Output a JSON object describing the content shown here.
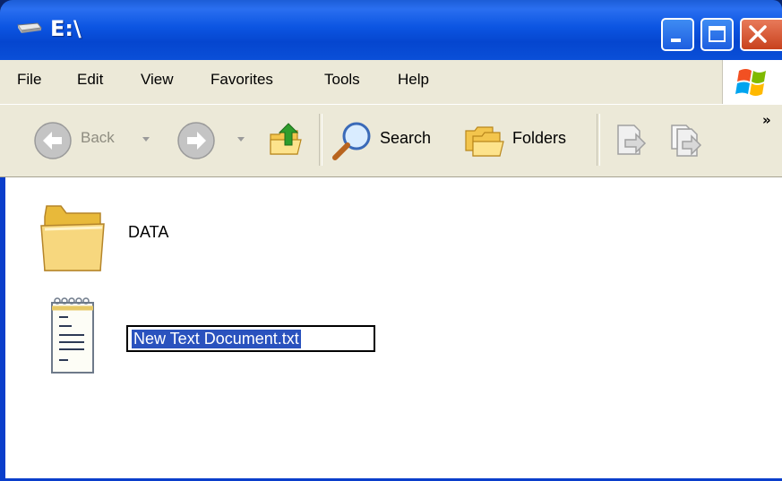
{
  "window": {
    "title": "E:\\"
  },
  "menubar": {
    "items": [
      "File",
      "Edit",
      "View",
      "Favorites",
      "Tools",
      "Help"
    ]
  },
  "toolbar": {
    "back_label": "Back",
    "search_label": "Search",
    "folders_label": "Folders",
    "overflow": "»"
  },
  "content": {
    "items": [
      {
        "label": "DATA",
        "icon": "folder-icon"
      },
      {
        "label": "New Text Document.txt",
        "icon": "text-document-icon",
        "renaming": true
      }
    ]
  },
  "colors": {
    "titlebar": "#0c55e2",
    "chrome": "#ece9d8",
    "selection": "#2a52be"
  }
}
